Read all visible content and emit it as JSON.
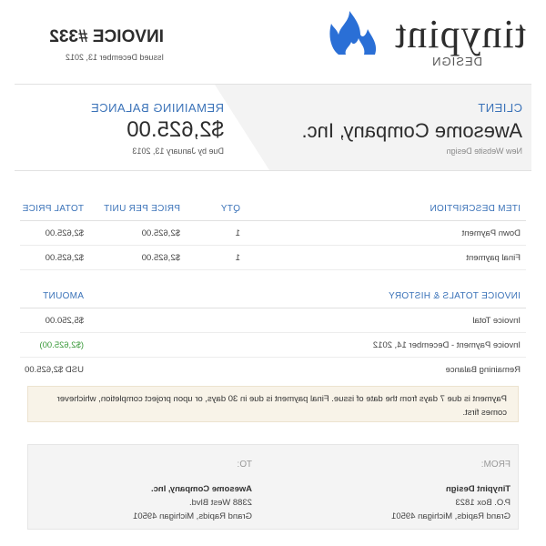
{
  "brand": {
    "name": "tinypint",
    "sub": "DESIGN",
    "flame_color": "#2a6fd6",
    "accent": "#3a72b8"
  },
  "invoice": {
    "title": "INVOICE #332",
    "issued": "Issued December 13, 2012"
  },
  "client": {
    "label": "CLIENT",
    "name": "Awesome Company, Inc.",
    "project": "New Website Design"
  },
  "balance": {
    "label": "REMAINING BALANCE",
    "amount": "$2,625.00",
    "due": "Due by January 13, 2013"
  },
  "items": {
    "headers": {
      "description": "ITEM DESCRIPTION",
      "qty": "QTY",
      "price_per_unit": "PRICE PER UNIT",
      "total_price": "TOTAL PRICE"
    },
    "rows": [
      {
        "description": "Down Payment",
        "qty": "1",
        "price_per_unit": "$2,625.00",
        "total_price": "$2,625.00"
      },
      {
        "description": "Final payment",
        "qty": "1",
        "price_per_unit": "$2,625.00",
        "total_price": "$2,625.00"
      }
    ]
  },
  "totals": {
    "headers": {
      "label": "INVOICE TOTALS & HISTORY",
      "amount": "AMOUNT"
    },
    "rows": [
      {
        "label": "Invoice Total",
        "amount": "$5,250.00"
      },
      {
        "label": "Invoice Payment - December 14, 2012",
        "amount": "($2,625.00)"
      },
      {
        "label": "Remaining Balance",
        "amount": "USD $2,625.00"
      }
    ]
  },
  "note": {
    "text": "Payment is due 7 days from the date of issue. Final payment is due in 30 days, or upon project completion, whichever comes first."
  },
  "from": {
    "label": "FROM:",
    "name": "Tinypint Design",
    "line1": "P.O. Box 1823",
    "line2": "Grand Rapids, Michigan 49501"
  },
  "to": {
    "label": "TO:",
    "name": "Awesome Company, Inc.",
    "line1": "2388 West Blvd.",
    "line2": "Grand Rapids, Michigan 49501"
  }
}
